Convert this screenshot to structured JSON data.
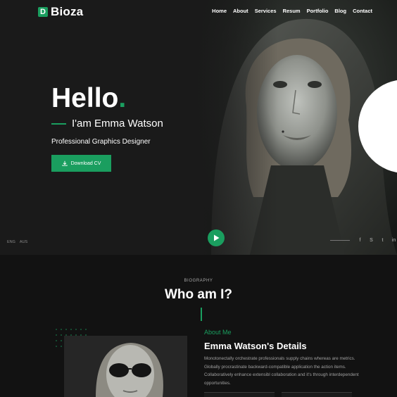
{
  "brand": {
    "logo_letter": "D",
    "name": "Bioza",
    "accent": "#1a9e5f"
  },
  "nav": {
    "items": [
      {
        "label": "Home"
      },
      {
        "label": "About"
      },
      {
        "label": "Services"
      },
      {
        "label": "Resum"
      },
      {
        "label": "Portfolio"
      },
      {
        "label": "Blog"
      },
      {
        "label": "Contact"
      }
    ]
  },
  "hero": {
    "greeting": "Hello",
    "greeting_dot": ".",
    "name": "I'am Emma Watson",
    "role": "Professional Graphics Designer",
    "cv_button": "Download CV",
    "cv_icon": "download-icon",
    "play_icon": "play-icon"
  },
  "languages": [
    "ENG",
    "AUS"
  ],
  "socials": [
    {
      "icon": "facebook-icon",
      "glyph": "f"
    },
    {
      "icon": "skype-icon",
      "glyph": "S"
    },
    {
      "icon": "twitter-icon",
      "glyph": "t"
    },
    {
      "icon": "linkedin-icon",
      "glyph": "in"
    }
  ],
  "biography": {
    "label": "BIOGRAPHY",
    "title": "Who am I?",
    "about_label": "About Me",
    "details_title": "Emma Watson's Details",
    "details_text": "Monotonectally orchestrate professionals supply chains whereas are metrics. Globally procrastinate backward-compatible application the action items. Collaboratively enhance extensibl collaboration and it's through interdependent opportunities."
  }
}
